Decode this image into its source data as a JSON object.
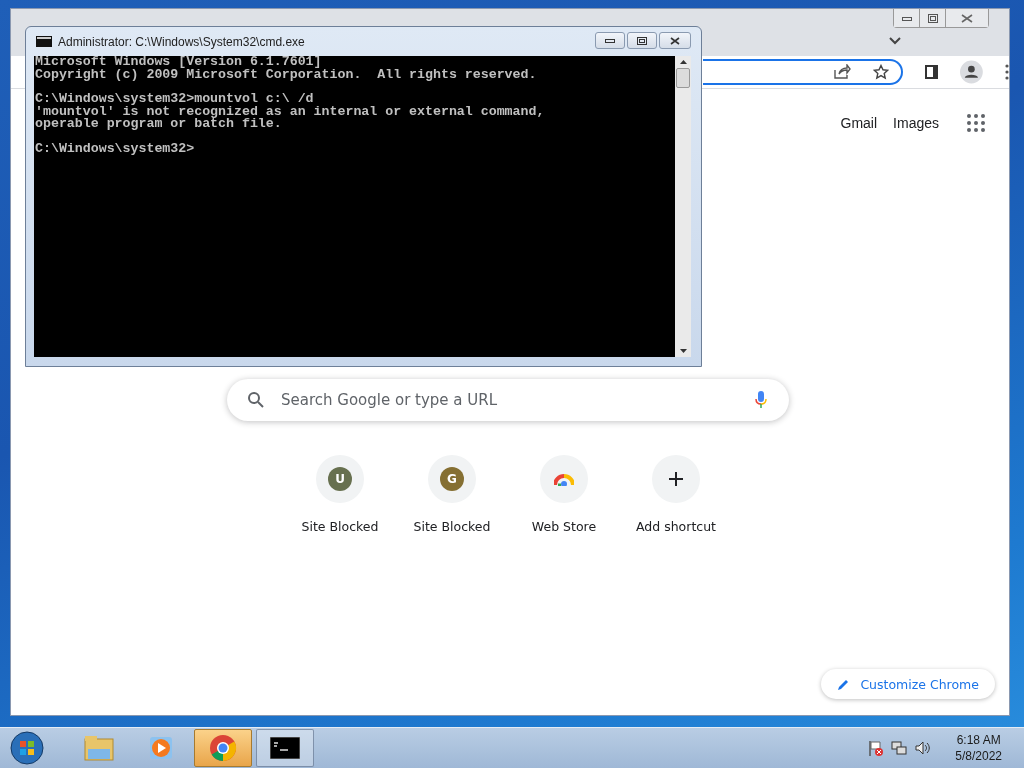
{
  "browser": {
    "top_links": [
      "Gmail",
      "Images"
    ],
    "search": {
      "placeholder": "Search Google or type a URL"
    },
    "shortcuts": [
      {
        "kind": "letter",
        "letter": "U",
        "label": "Site Blocked",
        "color": "#67704f"
      },
      {
        "kind": "letter",
        "letter": "G",
        "label": "Site Blocked",
        "color": "#856f32"
      },
      {
        "kind": "webstore",
        "label": "Web Store"
      },
      {
        "kind": "add",
        "label": "Add shortcut"
      }
    ],
    "customize_button": "Customize Chrome"
  },
  "console": {
    "title": "Administrator: C:\\Windows\\System32\\cmd.exe",
    "blocks": [
      [
        "Microsoft Windows [Version 6.1.7601]",
        "Copyright (c) 2009 Microsoft Corporation.  All rights reserved."
      ],
      [
        "C:\\Windows\\system32>mountvol c:\\ /d",
        "'mountvol' is not recognized as an internal or external command,",
        "operable program or batch file."
      ],
      [
        "C:\\Windows\\system32>"
      ]
    ]
  },
  "taskbar": {
    "items": [
      {
        "kind": "explorer",
        "selected": false
      },
      {
        "kind": "media",
        "selected": false
      },
      {
        "kind": "chrome",
        "selected": true
      },
      {
        "kind": "cmd",
        "selected": false
      }
    ],
    "time": "6:18 AM",
    "date": "5/8/2022"
  }
}
